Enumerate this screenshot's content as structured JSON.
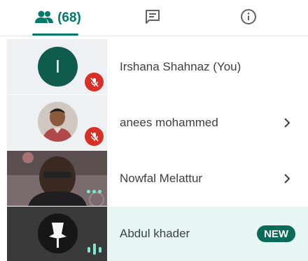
{
  "tabs": {
    "people": {
      "count": "(68)",
      "icon": "people-icon",
      "active": true
    },
    "chat": {
      "icon": "chat-icon"
    },
    "info": {
      "icon": "info-icon"
    }
  },
  "participants": [
    {
      "name": "Irshana Shahnaz (You)",
      "avatar_letter": "I",
      "muted": true,
      "chevron": false
    },
    {
      "name": "anees mohammed",
      "avatar": "photo",
      "muted": true,
      "chevron": true
    },
    {
      "name": "Nowfal Melattur",
      "video": true,
      "speaking_dots": true,
      "chevron": true
    },
    {
      "name": "Abdul khader",
      "avatar": "dark-photo",
      "speaking": true,
      "badge": "NEW"
    }
  ],
  "colors": {
    "accent": "#00796b",
    "mute_red": "#d93025",
    "avatar_green": "#0f5b4c",
    "new_badge": "#0b6a58",
    "highlight_row": "#e7f6f4"
  }
}
